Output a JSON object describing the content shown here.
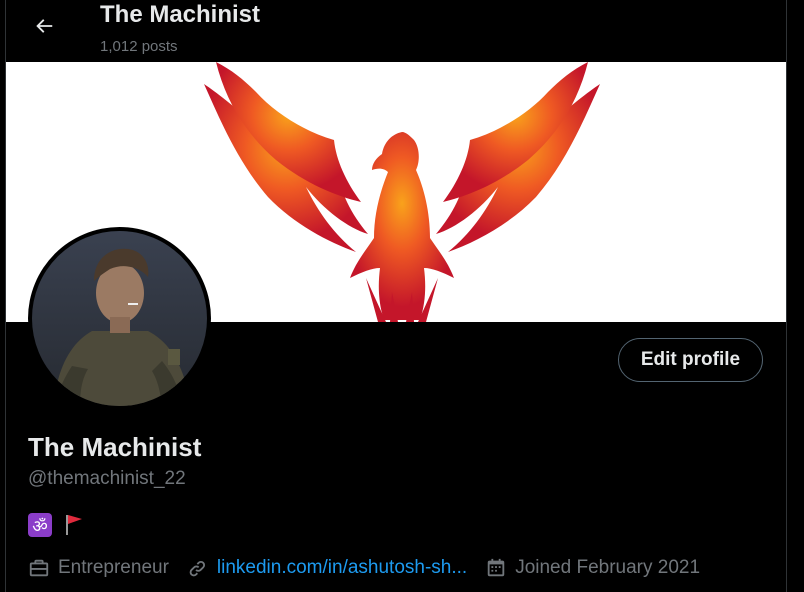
{
  "header": {
    "title": "The Machinist",
    "post_count": "1,012 posts",
    "back_icon": "arrow-left-icon"
  },
  "profile": {
    "display_name": "The Machinist",
    "handle": "@themachinist_22",
    "edit_button": "Edit profile",
    "bio_emojis": [
      "om-symbol",
      "red-flag"
    ],
    "profession": "Entrepreneur",
    "link": "linkedin.com/in/ashutosh-sh...",
    "joined": "Joined February 2021"
  },
  "colors": {
    "background": "#000000",
    "text_primary": "#e7e9ea",
    "text_secondary": "#71767b",
    "link": "#1d9bf0",
    "phoenix_red": "#c8202a",
    "phoenix_orange": "#f7941d"
  }
}
